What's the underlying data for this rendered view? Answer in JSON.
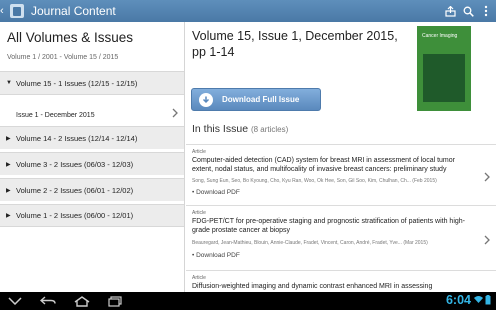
{
  "actionbar": {
    "back": "‹",
    "title": "Journal Content",
    "icons": [
      "share-icon",
      "search-icon",
      "menu-icon"
    ]
  },
  "sidebar": {
    "title": "All Volumes & Issues",
    "subtitle": "Volume 1 / 2001 - Volume 15 / 2015",
    "volumes": [
      {
        "label": "Volume 15 - 1 Issues (12/15 - 12/15)",
        "expanded": true
      },
      {
        "label": "Volume 14 - 2 Issues (12/14 - 12/14)",
        "expanded": false
      },
      {
        "label": "Volume 3 - 2 Issues (06/03 - 12/03)",
        "expanded": false
      },
      {
        "label": "Volume 2 - 2 Issues (06/01 - 12/02)",
        "expanded": false
      },
      {
        "label": "Volume 1 - 2 Issues (06/00 - 12/01)",
        "expanded": false
      }
    ],
    "issue": "Issue 1 - December 2015"
  },
  "main": {
    "heading": "Volume 15, Issue 1, December 2015, pp 1-14",
    "cover_title": "Cancer Imaging",
    "download_label": "Download Full Issue",
    "in_issue": "In this Issue",
    "article_count": "(8 articles)",
    "articles": [
      {
        "type": "Article",
        "title": "Computer-aided detection (CAD) system for breast MRI in assessment of local tumor extent, nodal status, and multifocality of invasive breast cancers: preliminary study",
        "authors": "Song, Sung Eun, Seo, Bo Kyoung, Cho, Kyu Ran, Woo, Ok Hee, Son, Gil Soo, Kim, Chulhan, Ch... (Feb 2015)",
        "download": "Download PDF"
      },
      {
        "type": "Article",
        "title": "FDG-PET/CT for pre-operative staging and prognostic stratification of patients with high-grade prostate cancer at biopsy",
        "authors": "Beauregard, Jean-Mathieu, Blouin, Annie-Claude, Fradet, Vincent, Caron, André, Fradet, Yve... (Mar 2015)",
        "download": "Download PDF"
      },
      {
        "type": "Article",
        "title": "Diffusion-weighted imaging and dynamic contrast enhanced MRI in assessing",
        "authors": "",
        "download": ""
      }
    ]
  },
  "navbar": {
    "clock": "6:04"
  },
  "colors": {
    "actionbar": "#4f7fab",
    "accent": "#33b5e5",
    "button": "#6b9bcb"
  }
}
